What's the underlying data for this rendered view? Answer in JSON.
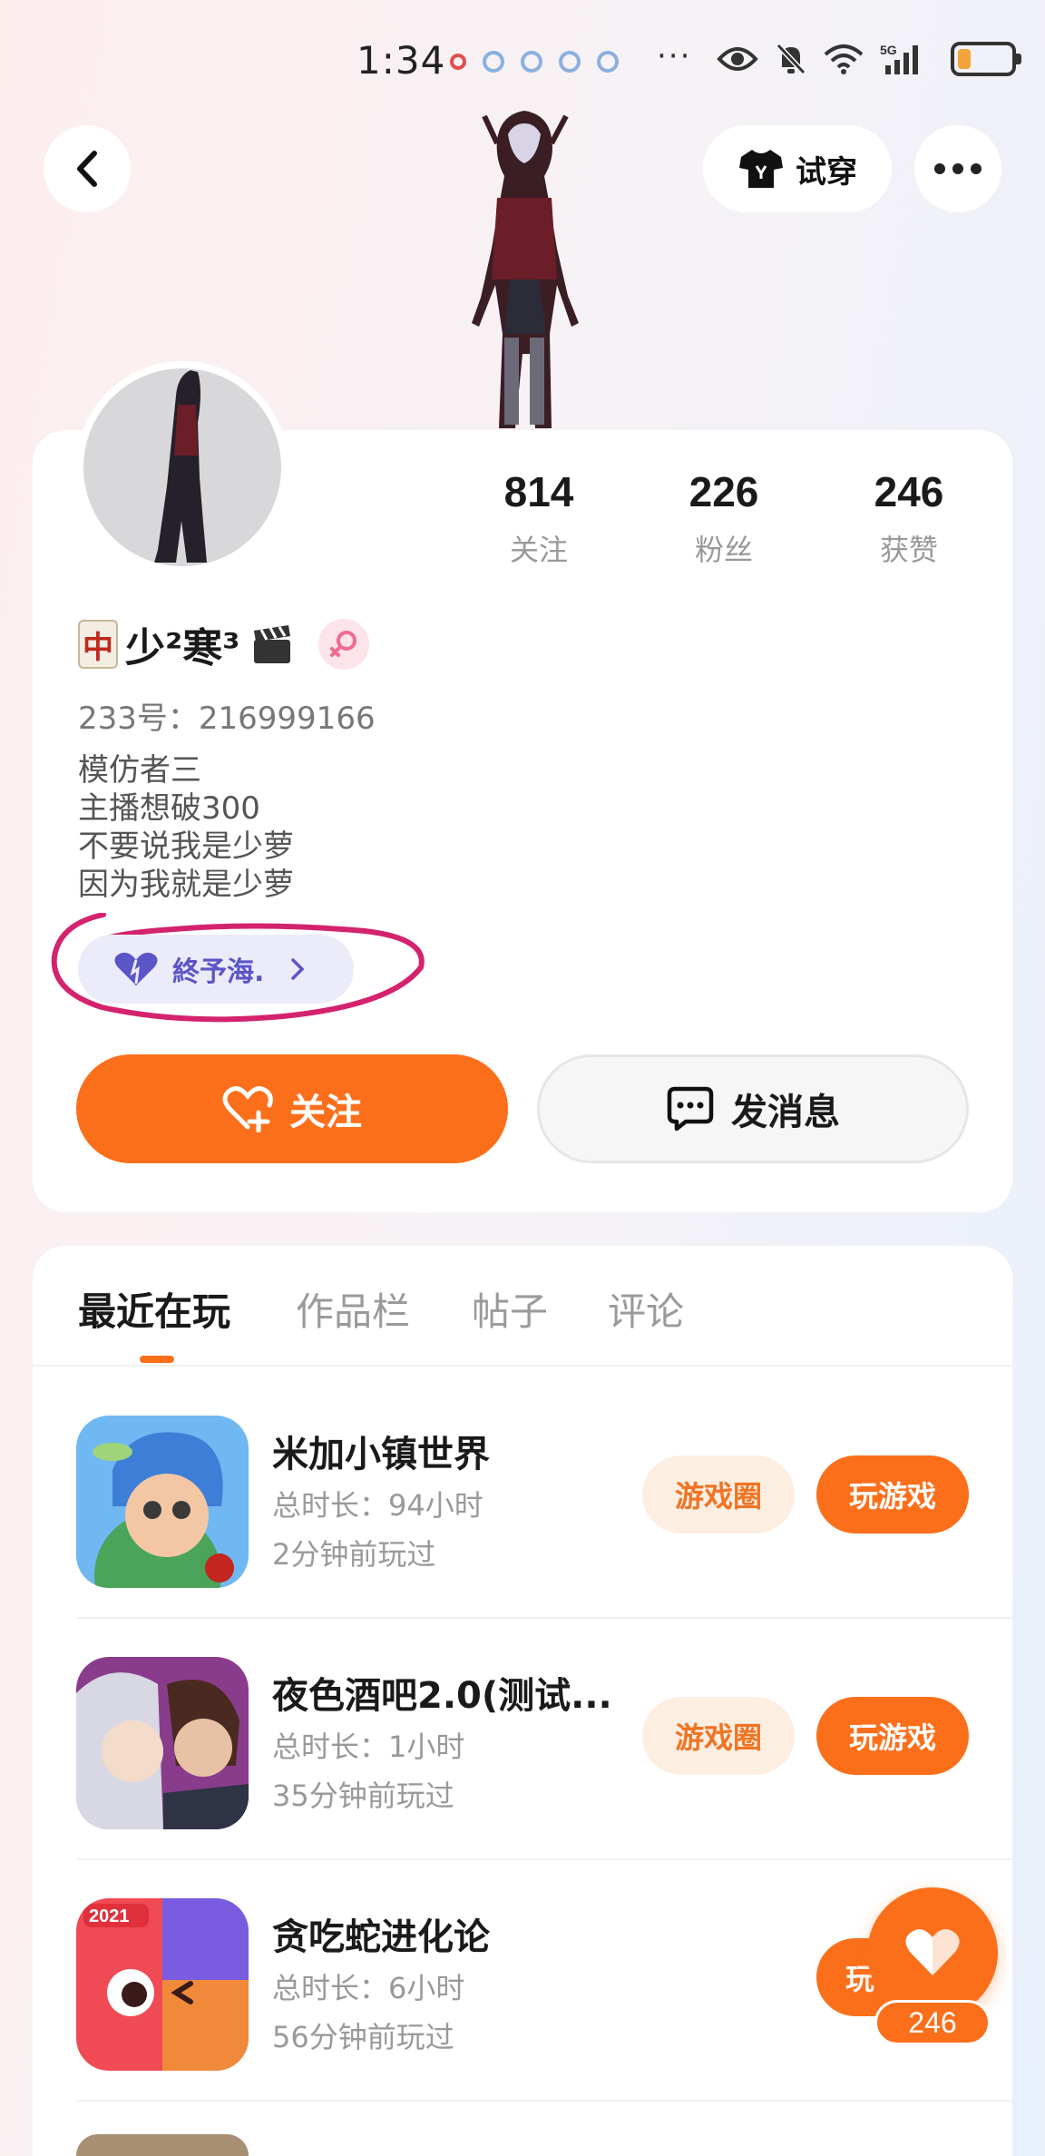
{
  "status_bar": {
    "time": "1:34",
    "more": "···",
    "network": "5G"
  },
  "header": {
    "tryon_label": "试穿"
  },
  "stats": [
    {
      "value": "814",
      "label": "关注"
    },
    {
      "value": "226",
      "label": "粉丝"
    },
    {
      "value": "246",
      "label": "获赞"
    }
  ],
  "profile": {
    "username": "少²寒³",
    "mahjong_tile": "中",
    "uid": "233号：216999166",
    "bio": [
      "模仿者三",
      "主播想破300",
      "不要说我是少萝",
      "因为我就是少萝"
    ],
    "cp_name": "終予海."
  },
  "actions": {
    "follow_label": "关注",
    "message_label": "发消息"
  },
  "tabs": [
    "最近在玩",
    "作品栏",
    "帖子",
    "评论"
  ],
  "games": [
    {
      "name": "米加小镇世界",
      "duration": "总时长：94小时",
      "last_played": "2分钟前玩过",
      "circle_label": "游戏圈",
      "play_label": "玩游戏"
    },
    {
      "name": "夜色酒吧2.0(测试...",
      "duration": "总时长：1小时",
      "last_played": "35分钟前玩过",
      "circle_label": "游戏圈",
      "play_label": "玩游戏"
    },
    {
      "name": "贪吃蛇进化论",
      "duration": "总时长：6小时",
      "last_played": "56分钟前玩过",
      "circle_label": "",
      "play_label": "玩",
      "icon_badge": "2021"
    }
  ],
  "like": {
    "count": "246"
  },
  "colors": {
    "accent": "#fb6f1b",
    "accent_light": "#fdeee2",
    "cp_purple": "#5b55c7",
    "circle_mark": "#d4236e"
  }
}
